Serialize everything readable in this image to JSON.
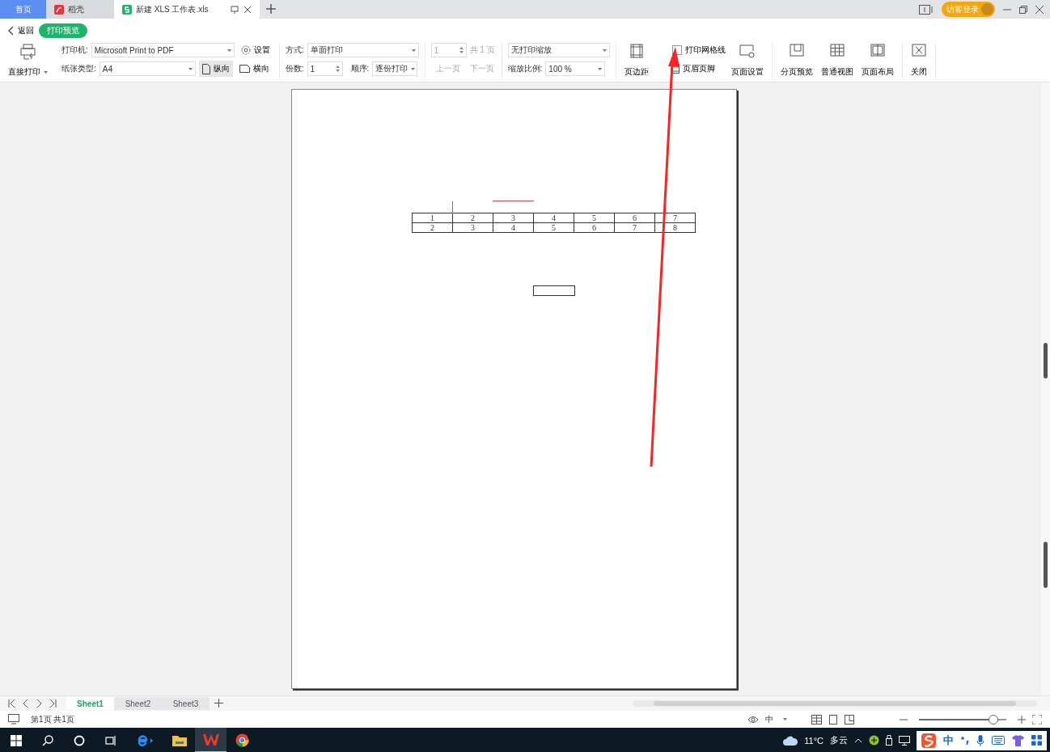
{
  "tabs": [
    {
      "label": "首页",
      "kind": "home",
      "selected": false
    },
    {
      "label": "稻壳",
      "kind": "docer",
      "selected": false
    },
    {
      "label": "新建 XLS 工作表.xls",
      "kind": "sheet",
      "selected": true
    }
  ],
  "login_button": "访客登录",
  "back": "返回",
  "mode_badge": "打印预览",
  "print": {
    "direct_print": "直接打印",
    "printer_label": "打印机:",
    "printer": "Microsoft Print to PDF",
    "paper_label": "纸张类型:",
    "paper": "A4",
    "settings": "设置",
    "orientations": [
      {
        "label": "纵向",
        "kind": "portrait",
        "selected": true
      },
      {
        "label": "横向",
        "kind": "landscape",
        "selected": false
      }
    ],
    "mode_label": "方式:",
    "mode": "单面打印",
    "copies_label": "份数:",
    "copies": "1",
    "order_label": "顺序:",
    "order": "逐份打印",
    "page": "1",
    "total": "共 1 页",
    "prev": {
      "label": "上一页",
      "disabled": true
    },
    "next": {
      "label": "下一页",
      "disabled": true
    },
    "scaling": "无打印缩放",
    "zoom_label": "缩放比例:",
    "zoom": "100 %",
    "margins": "页边距",
    "gridlines": {
      "label": "打印网格线",
      "checked": false
    },
    "header_footer": "页眉页脚",
    "page_setup": "页面设置"
  },
  "views": [
    {
      "label": "分页预览",
      "kind": "pagebreak"
    },
    {
      "label": "普通视图",
      "kind": "normal"
    },
    {
      "label": "页面布局",
      "kind": "layout"
    },
    {
      "label": "关闭",
      "kind": "close"
    }
  ],
  "sheet": {
    "rows": [
      [
        "1",
        "2",
        "3",
        "4",
        "5",
        "6",
        "7"
      ],
      [
        "2",
        "3",
        "4",
        "5",
        "6",
        "7",
        "8"
      ]
    ]
  },
  "sheet_tabs": [
    {
      "label": "Sheet1",
      "selected": true
    },
    {
      "label": "Sheet2",
      "selected": false
    },
    {
      "label": "Sheet3",
      "selected": false
    }
  ],
  "status": "第1页 共1页",
  "input_mode": "中",
  "zoom_slider": {
    "level": 0.85
  },
  "taskbar": {
    "temperature": "11°C",
    "weather": "多云",
    "ime": "中"
  }
}
